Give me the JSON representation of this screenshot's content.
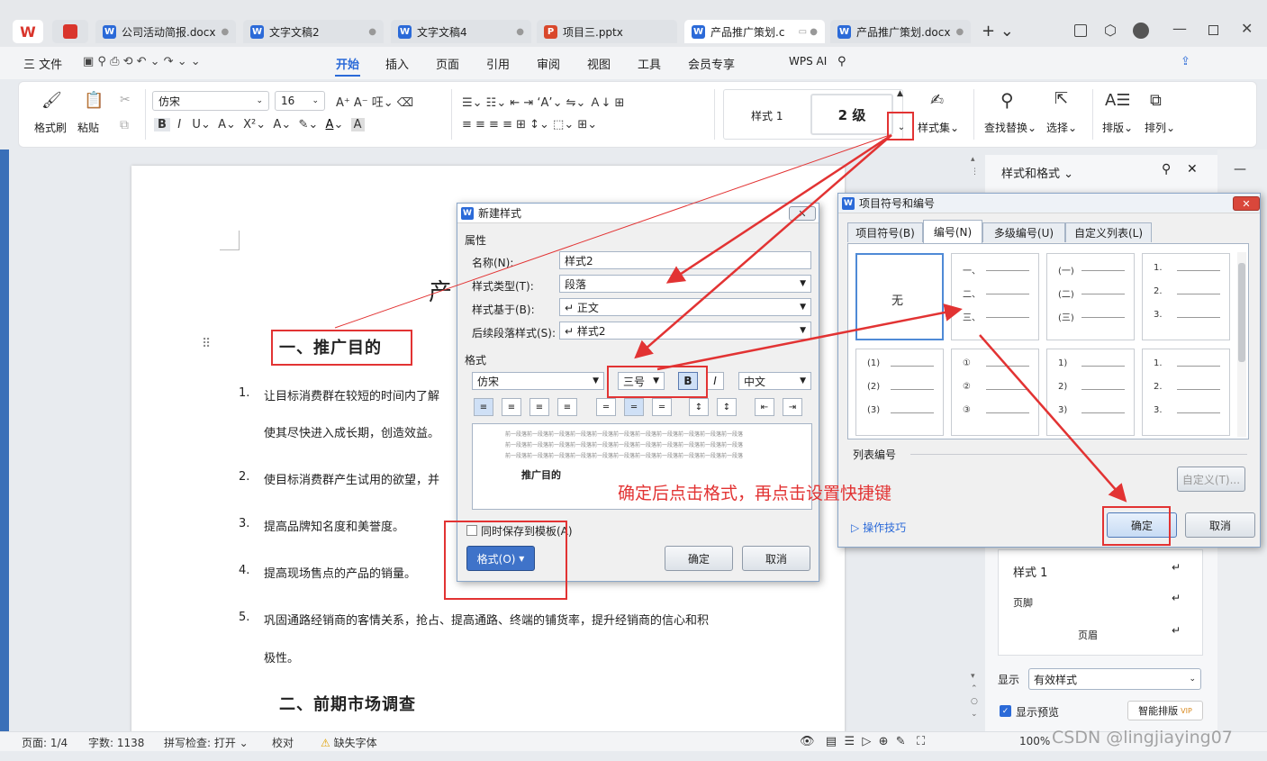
{
  "tabs": [
    {
      "label": "公司活动简报.docx",
      "type": "W"
    },
    {
      "label": "文字文稿2",
      "type": "W"
    },
    {
      "label": "文字文稿4",
      "type": "W"
    },
    {
      "label": "项目三.pptx",
      "type": "P"
    },
    {
      "label": "产品推广策划.c",
      "type": "W"
    },
    {
      "label": "产品推广策划.docx",
      "type": "W"
    }
  ],
  "menu": {
    "file": "三 文件",
    "items": [
      "开始",
      "插入",
      "页面",
      "引用",
      "审阅",
      "视图",
      "工具",
      "会员专享"
    ],
    "wps_ai": "WPS AI",
    "share": "分享"
  },
  "ribbon": {
    "format_painter": "格式刷",
    "paste": "粘贴",
    "font_name": "仿宋",
    "font_size": "16",
    "style1": "样式 1",
    "style_level2": "2 级",
    "style_set": "样式集",
    "find_replace": "查找替换",
    "select": "选择",
    "layout": "排版",
    "arrange": "排列"
  },
  "document": {
    "title_partial": "产",
    "heading1": "一、推广目的",
    "items": [
      {
        "num": "1.",
        "text": "让目标消费群在较短的时间内了解",
        "cont": "使其尽快进入成长期，创造效益。"
      },
      {
        "num": "2.",
        "text": "使目标消费群产生试用的欲望，并"
      },
      {
        "num": "3.",
        "text": "提高品牌知名度和美誉度。"
      },
      {
        "num": "4.",
        "text": "提高现场售点的产品的销量。"
      },
      {
        "num": "5.",
        "text": "巩固通路经销商的客情关系，抢占、提高通路、终端的铺货率，提升经销商的信心和积",
        "cont": "极性。"
      }
    ],
    "heading2": "二、前期市场调查"
  },
  "new_style_dialog": {
    "title": "新建样式",
    "attributes": "属性",
    "name_label": "名称(N):",
    "name_value": "样式2",
    "type_label": "样式类型(T):",
    "type_value": "段落",
    "based_label": "样式基于(B):",
    "based_value": "↵ 正文",
    "next_label": "后续段落样式(S):",
    "next_value": "↵ 样式2",
    "format_section": "格式",
    "font": "仿宋",
    "size": "三号",
    "bold": "B",
    "italic": "I",
    "lang": "中文",
    "preview_line": "前一段落前一段落前一段落前一段落前一段落前一段落前一段落前一段落前一段落前一段落前一段落",
    "preview_text": "推广目的",
    "save_template": "同时保存到模板(A)",
    "format_button": "格式(O)",
    "ok": "确定",
    "cancel": "取消"
  },
  "bullets_dialog": {
    "title": "项目符号和编号",
    "tabs": [
      "项目符号(B)",
      "编号(N)",
      "多级编号(U)",
      "自定义列表(L)"
    ],
    "none": "无",
    "list_numbering": "列表编号",
    "customize": "自定义(T)...",
    "tips": "操作技巧",
    "ok": "确定",
    "cancel": "取消",
    "grid": [
      [
        "一、",
        "二、",
        "三、"
      ],
      [
        "(一)",
        "(二)",
        "(三)"
      ],
      [
        "1.",
        "2.",
        "3."
      ],
      [
        "(1)",
        "(2)",
        "(3)"
      ],
      [
        "①",
        "②",
        "③"
      ],
      [
        "1)",
        "2)",
        "3)"
      ],
      [
        "1.",
        "2.",
        "3."
      ]
    ]
  },
  "annotation": "确定后点击格式，再点击设置快捷键",
  "side_pane": {
    "title": "样式和格式",
    "styles": [
      "样式 1",
      "页脚",
      "页眉"
    ],
    "show_label": "显示",
    "show_value": "有效样式",
    "preview": "显示预览",
    "smart": "智能排版"
  },
  "status": {
    "page": "页面: 1/4",
    "words": "字数: 1138",
    "spell": "拼写检查: 打开",
    "proof": "校对",
    "missing_font": "缺失字体",
    "zoom": "100%"
  },
  "watermark": "CSDN @lingjiaying07",
  "colors": {
    "accent": "#2b6ad8",
    "red": "#e23333"
  }
}
